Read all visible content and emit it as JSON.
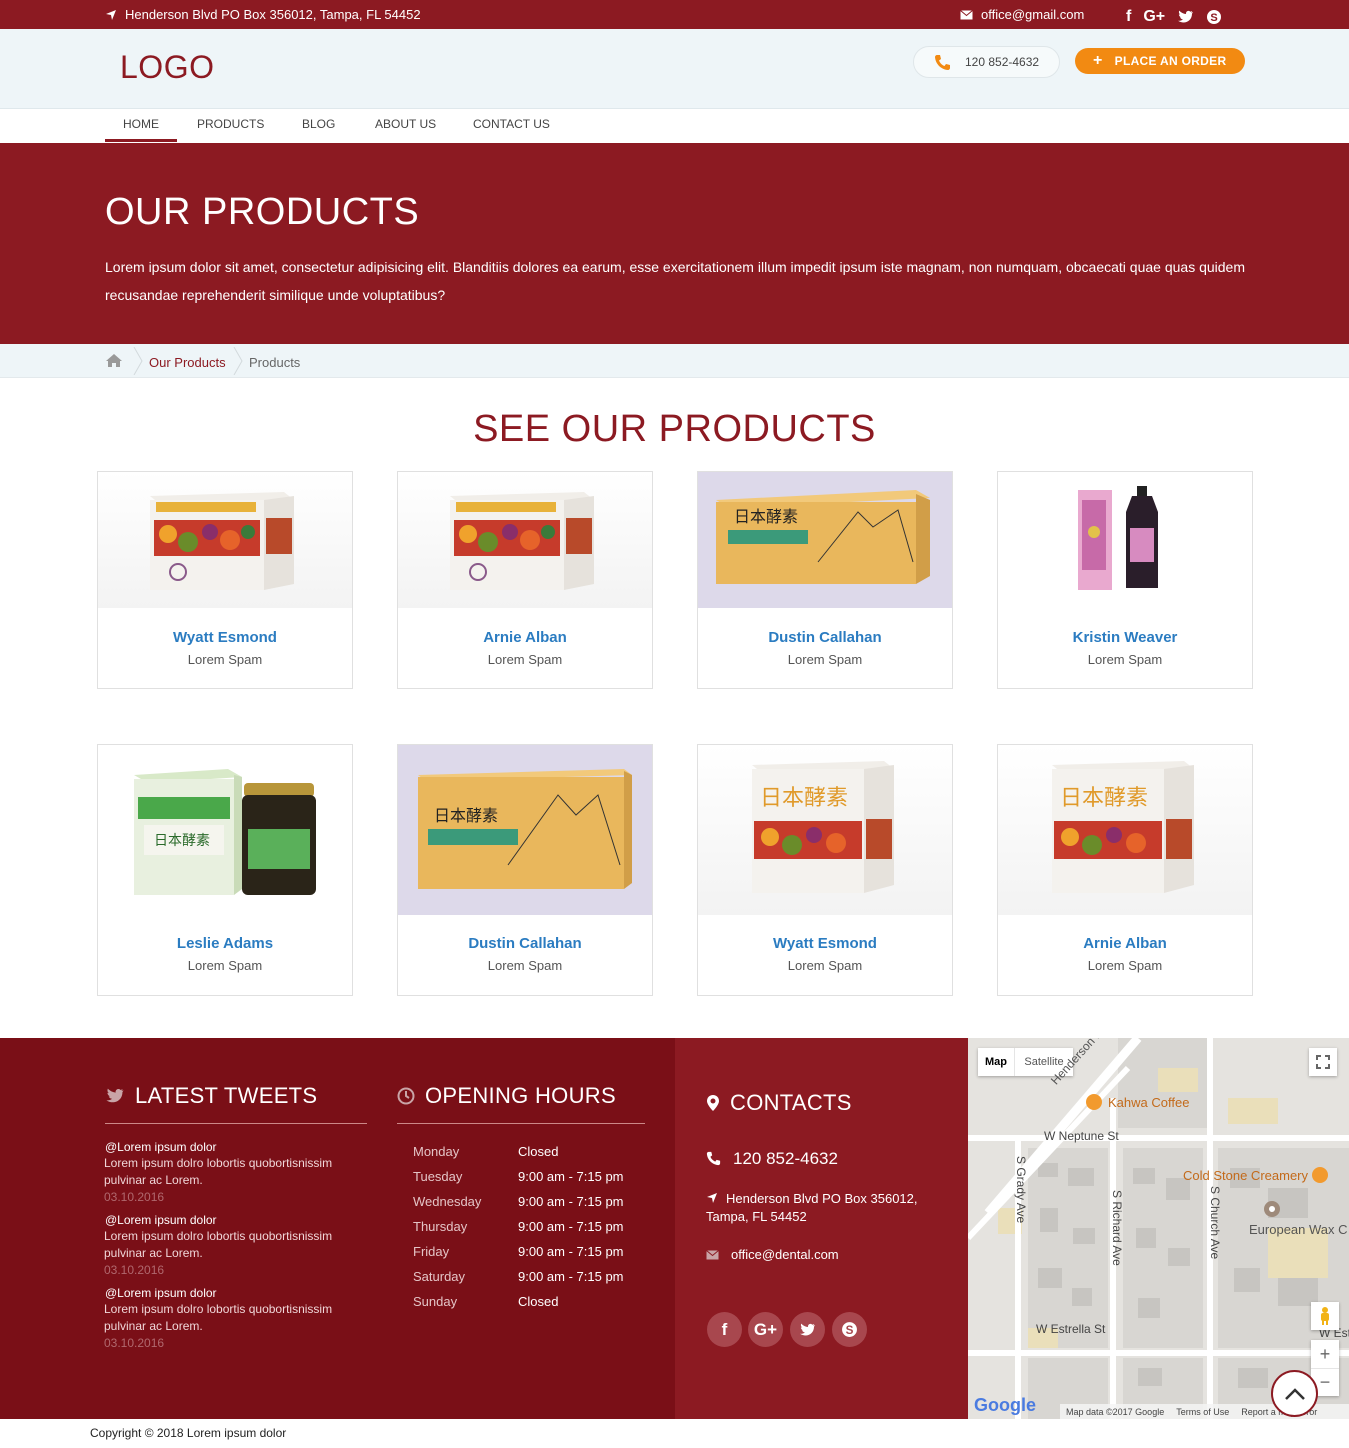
{
  "topbar": {
    "address": "Henderson Blvd PO Box 356012, Tampa, FL 54452",
    "email": "office@gmail.com",
    "social": [
      "f",
      "G+",
      "twitter-icon",
      "skype-icon"
    ]
  },
  "header": {
    "logo": "LOGO",
    "phone": "120 852-4632",
    "order_button": "PLACE AN ORDER"
  },
  "nav": {
    "items": [
      {
        "label": "HOME"
      },
      {
        "label": "PRODUCTS"
      },
      {
        "label": "BLOG"
      },
      {
        "label": "ABOUT US"
      },
      {
        "label": "CONTACT US"
      }
    ]
  },
  "hero": {
    "title": "OUR PRODUCTS",
    "text": "Lorem ipsum dolor sit amet, consectetur adipisicing elit. Blanditiis dolores ea earum, esse exercitationem illum impedit ipsum iste magnam, non numquam, obcaecati quae quas quidem recusandae reprehenderit similique unde voluptatibus?"
  },
  "breadcrumb": {
    "items": [
      "Our Products",
      "Products"
    ]
  },
  "products": {
    "title": "SEE OUR PRODUCTS",
    "items": [
      {
        "name": "Wyatt Esmond",
        "sub": "Lorem Spam"
      },
      {
        "name": "Arnie Alban",
        "sub": "Lorem Spam"
      },
      {
        "name": "Dustin Callahan",
        "sub": "Lorem Spam"
      },
      {
        "name": "Kristin Weaver",
        "sub": "Lorem Spam"
      },
      {
        "name": "Leslie Adams",
        "sub": "Lorem Spam"
      },
      {
        "name": "Dustin Callahan",
        "sub": "Lorem Spam"
      },
      {
        "name": "Wyatt Esmond",
        "sub": "Lorem Spam"
      },
      {
        "name": "Arnie Alban",
        "sub": "Lorem Spam"
      }
    ]
  },
  "footer": {
    "tweets_title": "LATEST TWEETS",
    "tweets": [
      {
        "handle": "@Lorem ipsum dolor",
        "body": "Lorem ipsum dolro lobortis quobortisnissim pulvinar ac Lorem.",
        "date": "03.10.2016"
      },
      {
        "handle": "@Lorem ipsum dolor",
        "body": "Lorem ipsum dolro lobortis quobortisnissim pulvinar ac Lorem.",
        "date": "03.10.2016"
      },
      {
        "handle": "@Lorem ipsum dolor",
        "body": "Lorem ipsum dolro lobortis quobortisnissim pulvinar ac Lorem.",
        "date": "03.10.2016"
      }
    ],
    "hours_title": "OPENING HOURS",
    "hours": [
      {
        "day": "Monday",
        "time": "Closed"
      },
      {
        "day": "Tuesday",
        "time": "9:00 am - 7:15 pm"
      },
      {
        "day": "Wednesday",
        "time": "9:00 am - 7:15 pm"
      },
      {
        "day": "Thursday",
        "time": "9:00 am - 7:15 pm"
      },
      {
        "day": "Friday",
        "time": "9:00 am - 7:15 pm"
      },
      {
        "day": "Saturday",
        "time": "9:00 am - 7:15 pm"
      },
      {
        "day": "Sunday",
        "time": "Closed"
      }
    ],
    "contacts_title": "CONTACTS",
    "phone": "120 852-4632",
    "address": "Henderson Blvd PO Box 356012, Tampa, FL 54452",
    "email": "office@dental.com",
    "social": [
      "f",
      "G+",
      "twitter-icon",
      "skype-icon"
    ]
  },
  "map": {
    "tab_map": "Map",
    "tab_satellite": "Satellite",
    "labels": {
      "henderson": "Henderson Blvd",
      "kahwa": "Kahwa Coffee",
      "neptune": "W Neptune St",
      "cold_stone": "Cold Stone Creamery",
      "grady": "S Grady Ave",
      "richard": "S Richard Ave",
      "church": "S Church Ave",
      "european": "European Wax C",
      "estrella": "W Estrella St",
      "estrella_right": "W Estr",
      "google": "Google",
      "attribution": "Map data ©2017 Google",
      "terms": "Terms of Use",
      "report": "Report a map error"
    }
  },
  "copyright": "Copyright © 2018 Lorem ipsum dolor"
}
